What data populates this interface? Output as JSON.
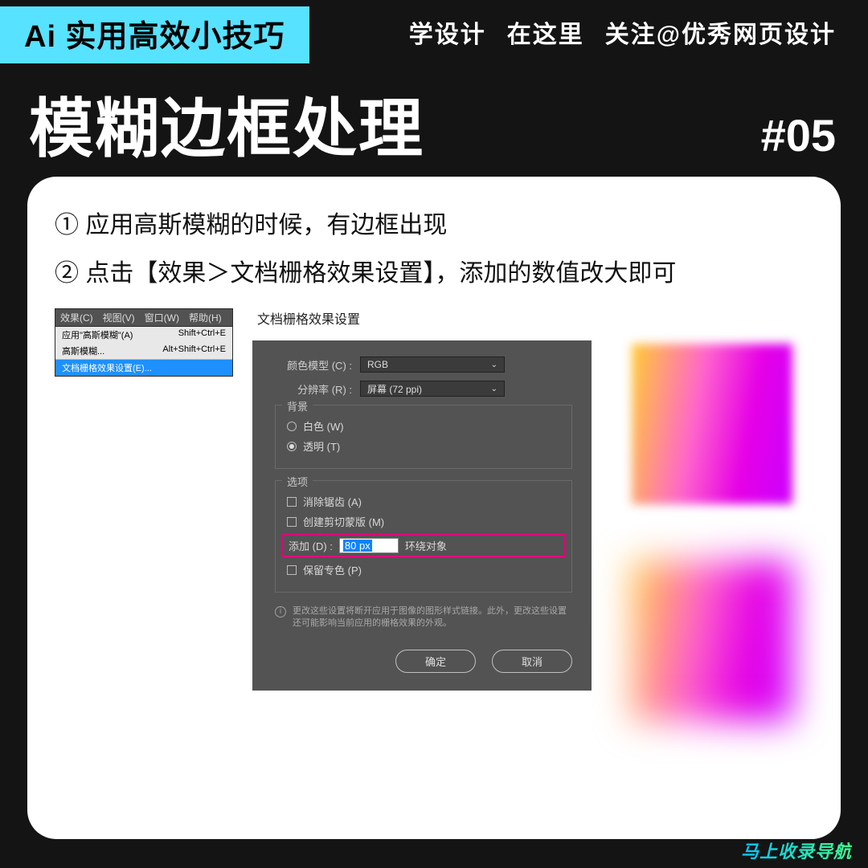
{
  "header": {
    "banner": "Ai 实用高效小技巧",
    "slogan1": "学设计",
    "slogan2": "在这里",
    "slogan3": "关注@优秀网页设计",
    "title": "模糊边框处理",
    "number": "#05"
  },
  "steps": {
    "s1": "① 应用高斯模糊的时候，有边框出现",
    "s2": "② 点击【效果＞文档栅格效果设置】，添加的数值改大即可"
  },
  "menu": {
    "bar": [
      "效果(C)",
      "视图(V)",
      "窗口(W)",
      "帮助(H)"
    ],
    "rows": [
      {
        "label": "应用\"高斯模糊\"(A)",
        "shortcut": "Shift+Ctrl+E"
      },
      {
        "label": "高斯模糊...",
        "shortcut": "Alt+Shift+Ctrl+E"
      }
    ],
    "selected": "文档栅格效果设置(E)..."
  },
  "dialog": {
    "title": "文档栅格效果设置",
    "color_model_label": "颜色模型 (C) :",
    "color_model_value": "RGB",
    "resolution_label": "分辨率 (R) :",
    "resolution_value": "屏幕 (72 ppi)",
    "bg_legend": "背景",
    "bg_white": "白色 (W)",
    "bg_trans": "透明 (T)",
    "opts_legend": "选项",
    "opt_aa": "消除锯齿 (A)",
    "opt_mask": "创建剪切蒙版 (M)",
    "add_label": "添加 (D) :",
    "add_value": "80 px",
    "add_suffix": "环绕对象",
    "opt_spot": "保留专色 (P)",
    "info": "更改这些设置将断开应用于图像的图形样式链接。此外，更改这些设置还可能影响当前应用的栅格效果的外观。",
    "ok": "确定",
    "cancel": "取消"
  },
  "watermark": "马上收录导航"
}
